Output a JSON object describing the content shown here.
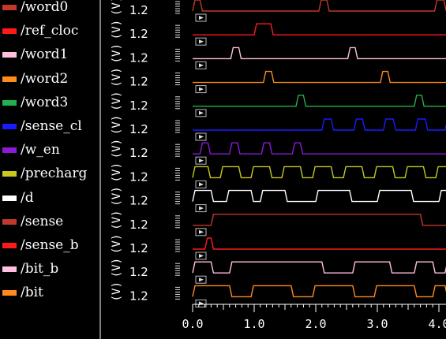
{
  "signals": [
    {
      "name": "/word0",
      "color": "#c0392b",
      "edges": [
        0.0,
        0.12,
        2.05,
        2.18,
        3.93,
        4.08
      ]
    },
    {
      "name": "/ref_cloc",
      "color": "#ff1a1a",
      "edges": [
        1.0,
        1.27
      ]
    },
    {
      "name": "/word1",
      "color": "#ffc0e0",
      "edges": [
        0.62,
        0.75,
        2.52,
        2.64
      ]
    },
    {
      "name": "/word2",
      "color": "#ff8c1a",
      "edges": [
        1.15,
        1.28,
        3.05,
        3.17
      ]
    },
    {
      "name": "/word3",
      "color": "#22b14c",
      "edges": [
        1.68,
        1.8,
        3.6,
        3.72
      ]
    },
    {
      "name": "/sense_cl",
      "color": "#1a1aff",
      "edges": [
        2.1,
        2.25,
        2.62,
        2.76,
        3.1,
        3.26,
        3.62,
        3.78,
        4.1,
        4.3
      ]
    },
    {
      "name": "/w_en",
      "color": "#8c1ad9",
      "edges": [
        0.12,
        0.25,
        0.6,
        0.73,
        1.12,
        1.25,
        1.62,
        1.75
      ]
    },
    {
      "name": "/precharg",
      "color": "#c8c81e",
      "edges": [
        0.0,
        0.25,
        0.45,
        0.75,
        0.95,
        1.25,
        1.45,
        1.75,
        1.95,
        2.25,
        2.45,
        2.75,
        2.95,
        3.25,
        3.45,
        3.75,
        3.95,
        4.25
      ]
    },
    {
      "name": "/d",
      "color": "#ffffff",
      "edges": [
        0.0,
        0.3,
        0.55,
        0.95,
        1.1,
        1.5,
        2.0,
        2.55,
        3.0,
        3.55,
        4.0,
        4.3
      ]
    },
    {
      "name": "/sense",
      "color": "#c0392b",
      "edges": [
        0.3,
        3.7
      ]
    },
    {
      "name": "/sense_b",
      "color": "#ff1a1a",
      "edges": [
        0.2,
        0.3
      ]
    },
    {
      "name": "/bit_b",
      "color": "#ffc0e0",
      "edges": [
        0.0,
        0.3,
        0.6,
        2.1,
        2.6,
        3.2,
        3.6,
        3.9,
        4.1
      ]
    },
    {
      "name": "/bit",
      "color": "#ff8c1a",
      "edges": [
        0.0,
        0.6,
        0.95,
        1.6,
        1.95,
        2.6,
        2.95,
        3.6,
        3.9,
        4.1
      ]
    }
  ],
  "trace_scale": "1.2",
  "trace_unit": "(V)",
  "timeline": {
    "ticks": [
      "0.0",
      "1.0",
      "2.0",
      "3.0",
      "4.0"
    ],
    "tick_values": [
      0,
      1,
      2,
      3,
      4
    ]
  }
}
